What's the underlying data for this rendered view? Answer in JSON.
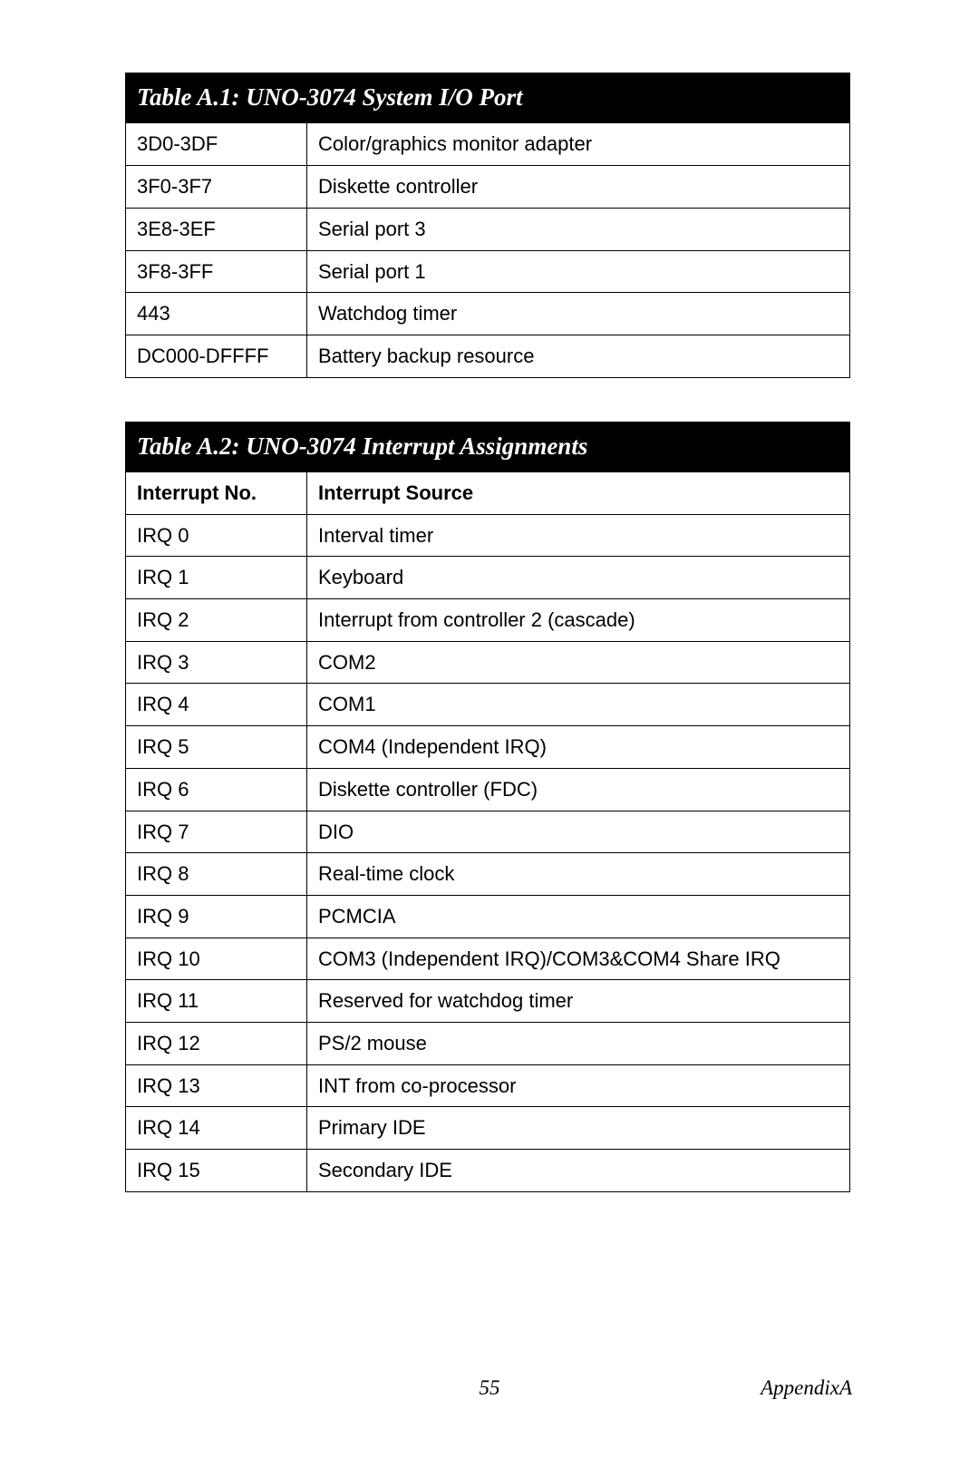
{
  "table1": {
    "title": "Table A.1: UNO-3074 System I/O Port",
    "rows": [
      {
        "a": "3D0-3DF",
        "b": "Color/graphics monitor adapter"
      },
      {
        "a": "3F0-3F7",
        "b": "Diskette controller"
      },
      {
        "a": "3E8-3EF",
        "b": "Serial port 3"
      },
      {
        "a": "3F8-3FF",
        "b": "Serial port 1"
      },
      {
        "a": "443",
        "b": "Watchdog timer"
      },
      {
        "a": "DC000-DFFFF",
        "b": "Battery backup resource"
      }
    ]
  },
  "table2": {
    "title": "Table A.2: UNO-3074 Interrupt Assignments",
    "header": {
      "a": "Interrupt No.",
      "b": "Interrupt Source"
    },
    "rows": [
      {
        "a": "IRQ 0",
        "b": "Interval timer"
      },
      {
        "a": "IRQ 1",
        "b": "Keyboard"
      },
      {
        "a": "IRQ 2",
        "b": "Interrupt from controller 2 (cascade)"
      },
      {
        "a": "IRQ 3",
        "b": "COM2"
      },
      {
        "a": "IRQ 4",
        "b": "COM1"
      },
      {
        "a": "IRQ 5",
        "b": "COM4 (Independent IRQ)"
      },
      {
        "a": "IRQ 6",
        "b": "Diskette controller (FDC)"
      },
      {
        "a": "IRQ 7",
        "b": "DIO"
      },
      {
        "a": "IRQ 8",
        "b": "Real-time clock"
      },
      {
        "a": "IRQ 9",
        "b": "PCMCIA"
      },
      {
        "a": "IRQ 10",
        "b": "COM3 (Independent IRQ)/COM3&COM4 Share IRQ"
      },
      {
        "a": "IRQ 11",
        "b": "Reserved for watchdog timer"
      },
      {
        "a": "IRQ 12",
        "b": "PS/2 mouse"
      },
      {
        "a": "IRQ 13",
        "b": "INT from co-processor"
      },
      {
        "a": "IRQ 14",
        "b": "Primary IDE"
      },
      {
        "a": "IRQ 15",
        "b": "Secondary IDE"
      }
    ]
  },
  "footer": {
    "page": "55",
    "appendix": "AppendixA"
  }
}
